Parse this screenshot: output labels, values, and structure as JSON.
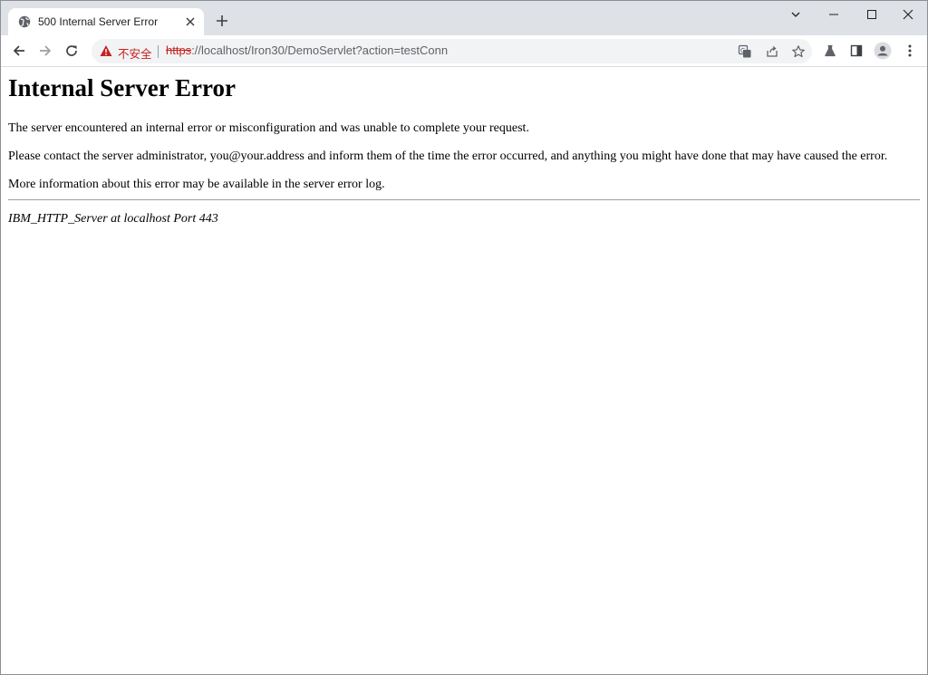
{
  "browser": {
    "tab": {
      "title": "500 Internal Server Error",
      "favicon": "globe-icon",
      "close_icon": "close-icon"
    },
    "new_tab_icon": "plus-icon",
    "window_controls": [
      "chevron-down-icon",
      "minimize-icon",
      "maximize-icon",
      "close-icon"
    ],
    "toolbar": {
      "back_icon": "arrow-left-icon",
      "forward_icon": "arrow-right-icon",
      "reload_icon": "reload-icon",
      "security_icon": "warning-icon",
      "security_label": "不安全",
      "url_scheme": "https",
      "url_rest": "://localhost/Iron30/DemoServlet?action=testConn",
      "omnibox_icons": [
        "translate-icon",
        "share-icon",
        "star-icon"
      ],
      "right_icons": [
        "labs-icon",
        "side-panel-icon",
        "profile-icon",
        "menu-icon"
      ]
    },
    "colors": {
      "tabstrip": "#dee1e6",
      "insecure_red": "#c5221f",
      "omnibox_bg": "#f1f3f4"
    }
  },
  "page": {
    "heading": "Internal Server Error",
    "paragraph_1": "The server encountered an internal error or misconfiguration and was unable to complete your request.",
    "paragraph_2": "Please contact the server administrator, you@your.address and inform them of the time the error occurred, and anything you might have done that may have caused the error.",
    "paragraph_3": "More information about this error may be available in the server error log.",
    "server_signature": "IBM_HTTP_Server at localhost Port 443"
  }
}
